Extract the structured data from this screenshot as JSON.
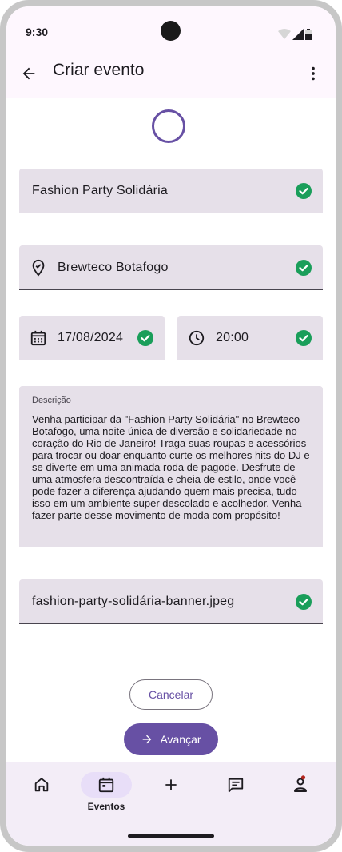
{
  "status_bar": {
    "time": "9:30",
    "icons": [
      "wifi-icon",
      "signal-icon",
      "battery-icon"
    ]
  },
  "app_bar": {
    "title": "Criar evento",
    "back_icon": "arrow-back-icon",
    "menu_icon": "more-vert-icon"
  },
  "form": {
    "event_name": "Fashion Party Solidária",
    "location": "Brewteco Botafogo",
    "date": "17/08/2024",
    "time": "20:00",
    "description_label": "Descrição",
    "description": "Venha participar da \"Fashion Party Solidária\" no Brewteco Botafogo, uma noite única de diversão e solidariedade no coração do Rio de Janeiro! Traga suas roupas e acessórios para trocar ou doar enquanto curte os melhores hits do DJ e se diverte em uma animada roda de pagode. Desfrute de uma atmosfera descontraída e cheia de estilo, onde você pode fazer a diferença ajudando quem mais precisa, tudo isso em um ambiente super descolado e acolhedor. Venha fazer parte desse movimento de moda com propósito!",
    "banner_file": "fashion-party-solidária-banner.jpeg"
  },
  "actions": {
    "cancel_label": "Cancelar",
    "next_label": "Avançar"
  },
  "bottom_nav": {
    "items": [
      {
        "icon": "home-icon",
        "label": ""
      },
      {
        "icon": "calendar-icon",
        "label": "Eventos",
        "active": true
      },
      {
        "icon": "add-icon",
        "label": ""
      },
      {
        "icon": "chat-icon",
        "label": ""
      },
      {
        "icon": "profile-icon",
        "label": "",
        "badge": true
      }
    ]
  },
  "colors": {
    "primary": "#6750a4",
    "success": "#1a9e5a",
    "field_bg": "#e6e0e9",
    "surface": "#fef7fe",
    "nav_bg": "#f3edf7"
  }
}
